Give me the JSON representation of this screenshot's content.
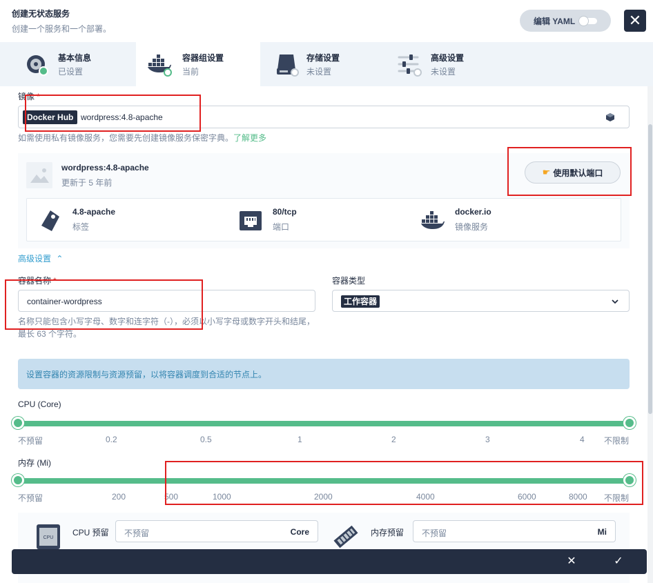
{
  "header": {
    "title": "创建无状态服务",
    "description": "创建一个服务和一个部署。",
    "yaml_toggle_label": "编辑 YAML",
    "close_symbol": "✕"
  },
  "tabs": [
    {
      "name": "基本信息",
      "status": "已设置",
      "icon": "basic-info-icon"
    },
    {
      "name": "容器组设置",
      "status": "当前",
      "icon": "docker-icon"
    },
    {
      "name": "存储设置",
      "status": "未设置",
      "icon": "storage-icon"
    },
    {
      "name": "高级设置",
      "status": "未设置",
      "icon": "advanced-settings-icon"
    }
  ],
  "image": {
    "label": "镜像",
    "required_mark": "*",
    "registry": "Docker Hub",
    "value": "wordpress:4.8-apache",
    "hint": "如需使用私有镜像服务，您需要先创建镜像服务保密字典。",
    "hint_link": "了解更多"
  },
  "image_card": {
    "name": "wordpress:4.8-apache",
    "updated": "更新于 5 年前",
    "port_button": "使用默认端口",
    "details": [
      {
        "value": "4.8-apache",
        "label": "标签",
        "icon": "tag-icon"
      },
      {
        "value": "80/tcp",
        "label": "端口",
        "icon": "ethernet-port-icon"
      },
      {
        "value": "docker.io",
        "label": "镜像服务",
        "icon": "docker-icon"
      }
    ]
  },
  "advanced_toggle": "高级设置",
  "container": {
    "name_label": "容器名称",
    "required_mark": "*",
    "name_value": "container-wordpress",
    "name_hint": "名称只能包含小写字母、数字和连字符（-），必须以小写字母或数字开头和结尾，最长 63 个字符。",
    "type_label": "容器类型",
    "type_value": "工作容器"
  },
  "resource_banner": "设置容器的资源限制与资源预留，以将容器调度到合适的节点上。",
  "cpu_slider": {
    "label": "CPU (Core)",
    "ticks": [
      "不预留",
      "0.2",
      "0.5",
      "1",
      "2",
      "3",
      "4",
      "不限制"
    ],
    "range": [
      "不预留",
      "不限制"
    ]
  },
  "memory_slider": {
    "label": "内存 (Mi)",
    "ticks": [
      "不预留",
      "200",
      "500",
      "1000",
      "2000",
      "4000",
      "6000",
      "8000",
      "不限制"
    ],
    "range": [
      "不预留",
      "不限制"
    ]
  },
  "reservations": {
    "cpu_label": "CPU 预留",
    "cpu_placeholder": "不预留",
    "cpu_unit": "Core",
    "mem_label": "内存预留",
    "mem_placeholder": "不预留",
    "mem_unit": "Mi"
  },
  "bottom_bar": {
    "cancel_symbol": "✕",
    "confirm_symbol": "✓"
  },
  "colors": {
    "primary_dark": "#242e42",
    "accent_green": "#55bc8a",
    "link_blue": "#329dce",
    "banner_bg": "#c7deef",
    "annotation_red": "#e02020"
  }
}
